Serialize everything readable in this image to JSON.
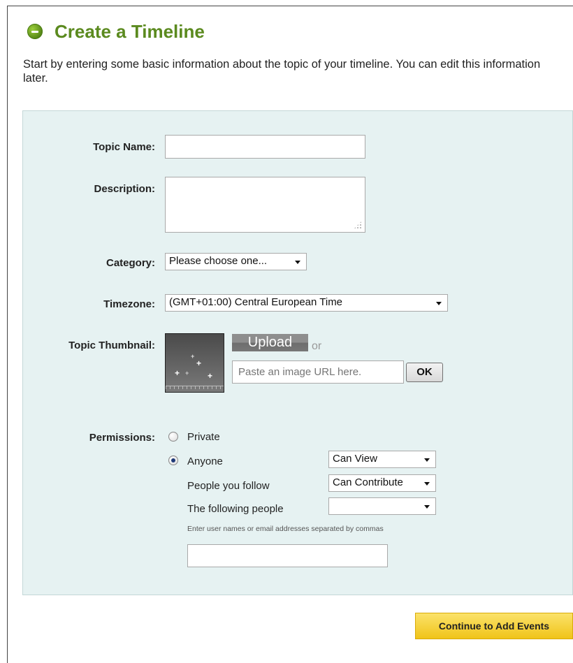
{
  "page": {
    "title": "Create a Timeline",
    "intro": "Start by entering some basic information about the topic of your timeline. You can edit this information later."
  },
  "form": {
    "topic_name_label": "Topic Name:",
    "topic_name_value": "",
    "description_label": "Description:",
    "description_value": "",
    "category_label": "Category:",
    "category_value": "Please choose one...",
    "timezone_label": "Timezone:",
    "timezone_value": "(GMT+01:00) Central European Time",
    "thumbnail_label": "Topic Thumbnail:",
    "upload_label": "Upload",
    "or_label": "or",
    "image_url_placeholder": "Paste an image URL here.",
    "ok_label": "OK",
    "permissions_label": "Permissions:",
    "permissions": {
      "private_label": "Private",
      "anyone_label": "Anyone",
      "selected": "Anyone",
      "anyone_access": "Can View",
      "people_you_follow_label": "People you follow",
      "people_you_follow_access": "Can Contribute",
      "following_people_label": "The following people",
      "following_people_access": "",
      "hint": "Enter user names or email addresses separated by commas",
      "people_value": ""
    }
  },
  "actions": {
    "continue_label": "Continue to Add Events"
  },
  "colors": {
    "title_green": "#5b8a1f",
    "panel_bg": "#e6f2f2",
    "button_yellow": "#f0c419"
  }
}
